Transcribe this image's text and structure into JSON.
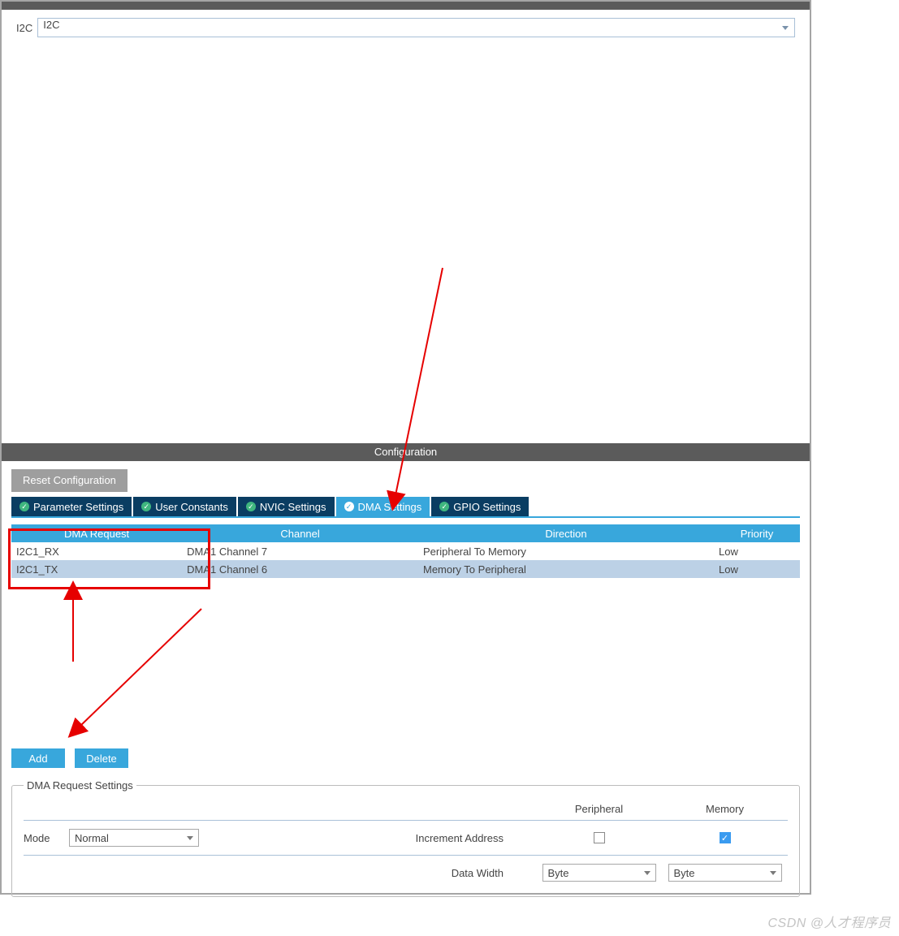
{
  "mode": {
    "label": "I2C",
    "value": "I2C"
  },
  "config_title": "Configuration",
  "reset_button": "Reset Configuration",
  "tabs": [
    {
      "label": "Parameter Settings"
    },
    {
      "label": "User Constants"
    },
    {
      "label": "NVIC Settings"
    },
    {
      "label": "DMA Settings"
    },
    {
      "label": "GPIO Settings"
    }
  ],
  "table": {
    "headers": [
      "DMA Request",
      "Channel",
      "Direction",
      "Priority"
    ],
    "rows": [
      {
        "req": "I2C1_RX",
        "chan": "DMA1 Channel 7",
        "dir": "Peripheral To Memory",
        "prio": "Low"
      },
      {
        "req": "I2C1_TX",
        "chan": "DMA1 Channel 6",
        "dir": "Memory To Peripheral",
        "prio": "Low"
      }
    ]
  },
  "add_label": "Add",
  "delete_label": "Delete",
  "settings": {
    "legend": "DMA Request Settings",
    "mode_label": "Mode",
    "mode_value": "Normal",
    "inc_addr_label": "Increment Address",
    "data_width_label": "Data Width",
    "peripheral_label": "Peripheral",
    "memory_label": "Memory",
    "peripheral_width": "Byte",
    "memory_width": "Byte"
  },
  "watermark": "CSDN @人才程序员"
}
